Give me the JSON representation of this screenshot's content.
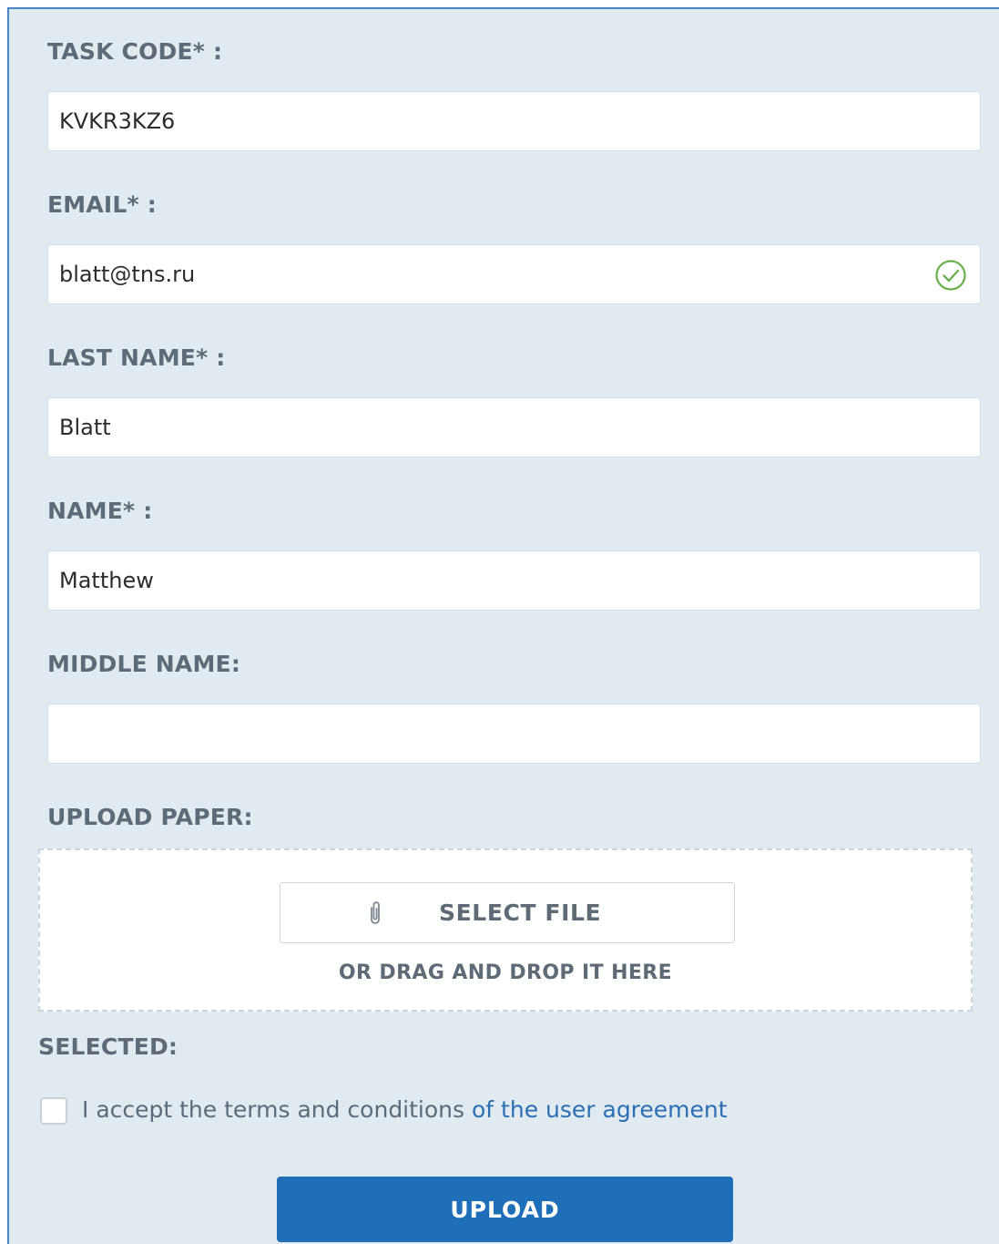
{
  "form": {
    "task_code": {
      "label": "TASK CODE* :",
      "value": "KVKR3KZ6"
    },
    "email": {
      "label": "EMAIL* :",
      "value": "blatt@tns.ru",
      "status_icon": "check-circle-icon",
      "status_color": "#6ab04c"
    },
    "last_name": {
      "label": "LAST NAME* :",
      "value": "Blatt"
    },
    "name": {
      "label": "NAME* :",
      "value": "Matthew"
    },
    "middle_name": {
      "label": "MIDDLE NAME:",
      "value": ""
    },
    "upload_paper": {
      "label": "UPLOAD PAPER:",
      "select_file_label": "SELECT FILE",
      "select_file_icon": "paperclip-icon",
      "drag_hint": "OR DRAG AND DROP IT HERE"
    },
    "selected": {
      "label": "SELECTED:"
    },
    "agreement": {
      "text": "I accept the terms and conditions ",
      "link_text": "of the user agreement",
      "checked": false
    },
    "submit": {
      "label": "UPLOAD"
    }
  },
  "colors": {
    "panel_background": "#e1eaf1",
    "panel_border": "#4a86c5",
    "label_text": "#5e6a75",
    "link": "#2a6fb3",
    "primary_button": "#1e6fb8"
  }
}
